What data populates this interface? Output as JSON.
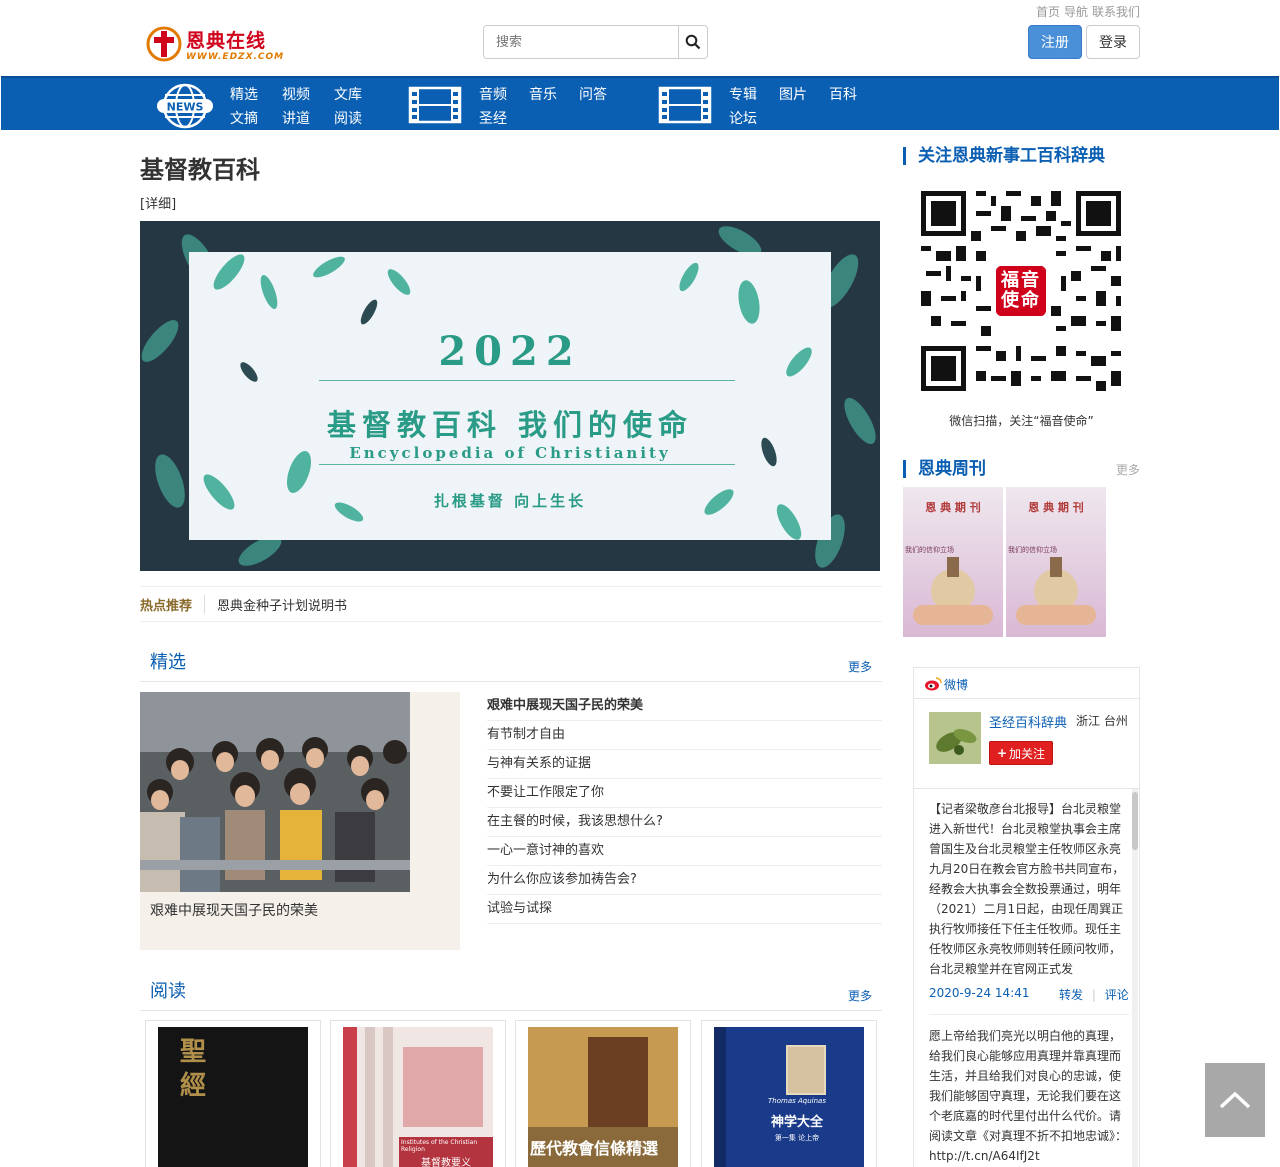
{
  "header": {
    "logo_text": "恩典在线",
    "logo_sub": "WWW.EDZX.COM",
    "search_placeholder": "搜索",
    "toplinks": [
      "首页",
      "导航",
      "联系我们"
    ],
    "register": "注册",
    "login": "登录"
  },
  "nav": {
    "icon1_label": "NEWS",
    "links": [
      "精选",
      "视频",
      "文库",
      "文摘",
      "讲道",
      "阅读",
      "音频",
      "音乐",
      "问答",
      "圣经",
      "专辑",
      "图片",
      "百科",
      "论坛"
    ]
  },
  "main": {
    "title": "基督教百科",
    "detail": "[详细]",
    "banner": {
      "year": "2022",
      "title": "基督教百科  我们的使命",
      "english": "Encyclopedia of Christianity",
      "motto": "扎根基督  向上生长"
    },
    "hot_label": "热点推荐",
    "hot_item": "恩典金种子计划说明书",
    "featured_section": {
      "title": "精选",
      "more": "更多"
    },
    "feature_caption": "艰难中展现天国子民的荣美",
    "articles": [
      "艰难中展现天国子民的荣美",
      "有节制才自由",
      "与神有关系的证据",
      "不要让工作限定了你",
      "在主餐的时候，我该思想什么?",
      "一心一意讨神的喜欢",
      "为什么你应该参加祷告会?",
      "试验与试探"
    ],
    "reading_section": {
      "title": "阅读",
      "more": "更多"
    },
    "books": [
      {
        "cover_text": "聖經"
      },
      {
        "cover_text": "基督教要义",
        "sub": "Institutes of the Christian Religion"
      },
      {
        "cover_text": "歷代教會信條精選"
      },
      {
        "cover_text": "神学大全",
        "author": "Thomas Aquinas",
        "sub": "第一集 论上帝"
      }
    ]
  },
  "sidebar": {
    "follow_title": "关注恩典新事工百科辞典",
    "qr_center": "福音使命",
    "qr_caption": "微信扫描，关注“福音使命”",
    "weekly_title": "恩典周刊",
    "weekly_more": "更多",
    "magazines": [
      {
        "title": "恩 典 期 刊",
        "sub": "我们的信仰立场"
      },
      {
        "title": "恩 典 期 刊",
        "sub": "我们的信仰立场"
      }
    ],
    "weibo": {
      "tab": "微博",
      "name": "圣经百科辞典",
      "location": "浙江 台州",
      "follow": "加关注",
      "post1": "【记者梁敬彦台北报导】台北灵粮堂进入新世代！台北灵粮堂执事会主席曾国生及台北灵粮堂主任牧师区永亮九月20日在教会官方脸书共同宣布，经教会大执事会全数投票通过，明年（2021）二月1日起，由现任周巽正执行牧师接任下任主任牧师。现任主任牧师区永亮牧师则转任顾问牧师，台北灵粮堂并在官网正式发",
      "post1_date": "2020-9-24 14:41",
      "repost": "转发",
      "comment": "评论",
      "post2": "愿上帝给我们亮光以明白他的真理，给我们良心能够应用真理并靠真理而生活，并且给我们对良心的忠诚，使我们能够固守真理，无论我们要在这个老底嘉的时代里付出什么代价。请阅读文章《对真理不折不扣地忠诚》：http://t.cn/A64IfJ2t"
    }
  },
  "colors": {
    "brand_blue": "#0b5fb3",
    "red": "#d0021b",
    "teal": "#2a9b86"
  }
}
